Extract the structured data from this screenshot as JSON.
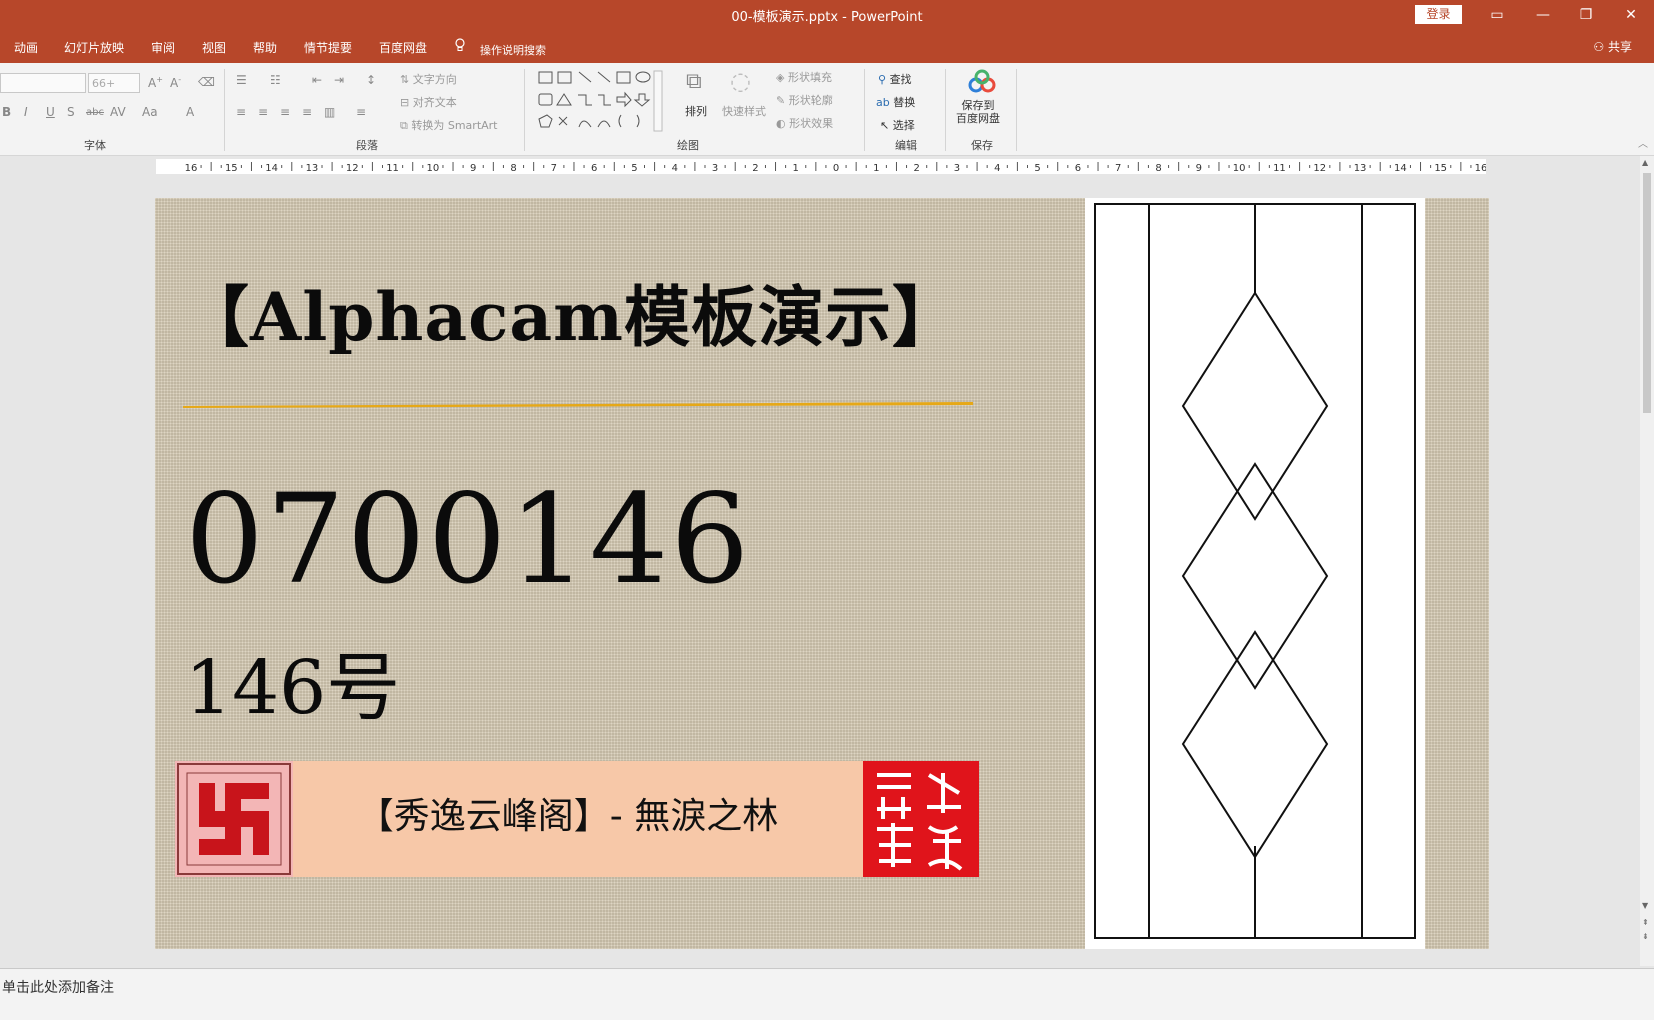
{
  "window": {
    "title": "00-模板演示.pptx  -  PowerPoint",
    "login_label": "登录",
    "share_label": "共享"
  },
  "tabs": [
    "动画",
    "幻灯片放映",
    "审阅",
    "视图",
    "帮助",
    "情节提要",
    "百度网盘"
  ],
  "tell_me": "操作说明搜索",
  "ribbon": {
    "font_name": "",
    "font_size": "66+",
    "groups": {
      "font": "字体",
      "paragraph": "段落",
      "drawing": "绘图",
      "editing": "编辑",
      "save": "保存"
    },
    "paragraph": {
      "text_direction": "文字方向",
      "align_text": "对齐文本",
      "convert_smartart": "转换为 SmartArt"
    },
    "drawing": {
      "arrange": "排列",
      "quick_styles": "快速样式",
      "shape_fill": "形状填充",
      "shape_outline": "形状轮廓",
      "shape_effects": "形状效果"
    },
    "editing": {
      "find": "查找",
      "replace": "替换",
      "select": "选择"
    },
    "save": {
      "save_to_baidu": "保存到\n百度网盘"
    }
  },
  "ruler": {
    "labels": [
      "16",
      "15",
      "14",
      "13",
      "12",
      "11",
      "10",
      "9",
      "8",
      "7",
      "6",
      "5",
      "4",
      "3",
      "2",
      "1",
      "0",
      "1",
      "2",
      "3",
      "4",
      "5",
      "6",
      "7",
      "8",
      "9",
      "10",
      "11",
      "12",
      "13",
      "14",
      "15",
      "16"
    ]
  },
  "slide": {
    "title": "【Alphacam模板演示】",
    "code": "0700146",
    "number": "146号",
    "banner_text": "【秀逸云峰阁】- 無淚之林",
    "seal_text": "秀逸雲峯",
    "accent_gold": "#e6a817",
    "seal_red": "#e0141b"
  },
  "notes": {
    "placeholder": "单击此处添加备注"
  }
}
